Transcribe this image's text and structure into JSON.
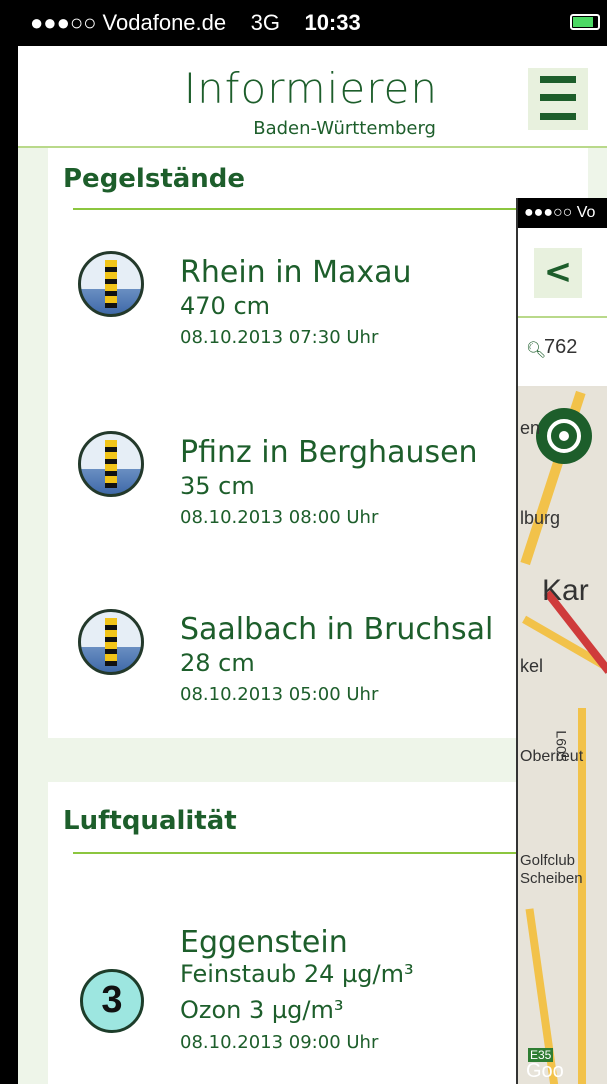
{
  "status_bar": {
    "carrier": "●●●○○ Vodafone.de",
    "network": "3G",
    "time": "10:33"
  },
  "header": {
    "title": "Informieren",
    "subtitle": "Baden-Württemberg"
  },
  "water_levels": {
    "title": "Pegelstände",
    "items": [
      {
        "name": "Rhein in Maxau",
        "value": "470 cm",
        "timestamp": "08.10.2013 07:30 Uhr"
      },
      {
        "name": "Pfinz in Berghausen",
        "value": "35 cm",
        "timestamp": "08.10.2013 08:00 Uhr"
      },
      {
        "name": "Saalbach in Bruchsal",
        "value": "28 cm",
        "timestamp": "08.10.2013 05:00 Uhr"
      }
    ]
  },
  "air_quality": {
    "title": "Luftqualität",
    "items": [
      {
        "index": "3",
        "name": "Eggenstein",
        "pm": "Feinstaub 24 µg/m³",
        "ozone": "Ozon 3 µg/m³",
        "timestamp": "08.10.2013 09:00 Uhr"
      }
    ]
  },
  "map_screen": {
    "status_text": "●●●○○ Vo",
    "back_glyph": "<",
    "search_value": "762",
    "labels": [
      "en",
      "lburg",
      "Kar",
      "kel",
      "Oberreut",
      "L605",
      "Golfclub",
      "Scheiben",
      "E35",
      "Goo"
    ]
  },
  "colors": {
    "brand_green": "#1d5e2b",
    "accent_green": "#8cc63f",
    "background": "#eef5e9"
  }
}
